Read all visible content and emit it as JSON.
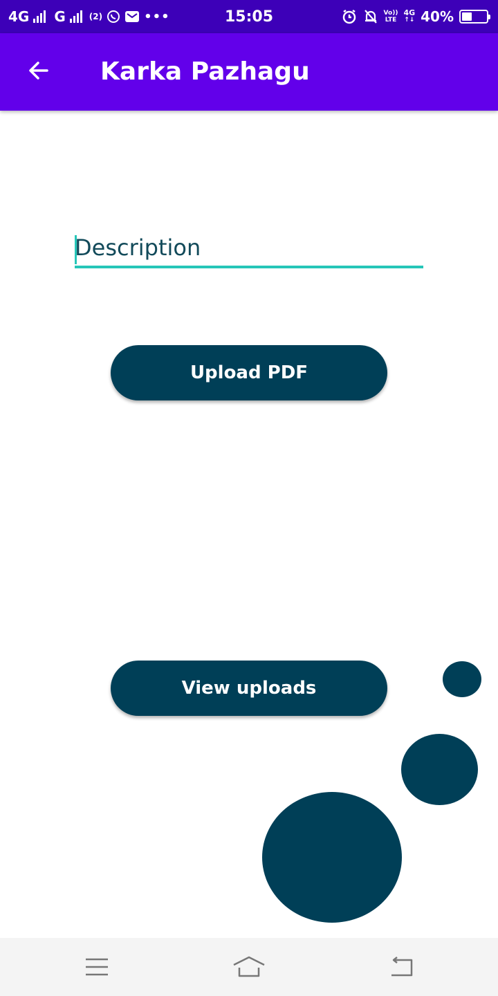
{
  "status_bar": {
    "network_1": "4G",
    "network_2": "G",
    "sim_badge": "(2)",
    "time": "15:05",
    "volte_top": "Vo))",
    "volte_bottom": "LTE",
    "net_right_top": "4G",
    "net_right_bottom": "↑↓",
    "battery_percent": "40%",
    "battery_level": 0.4,
    "icons": [
      "signal-icon",
      "sim-icon",
      "whatsapp-icon",
      "mail-icon",
      "more-dots-icon",
      "alarm-icon",
      "mute-icon",
      "battery-icon"
    ]
  },
  "app_bar": {
    "title": "Karka Pazhagu",
    "back_icon": "arrow-left-icon",
    "background": "#6200ea"
  },
  "form": {
    "description_placeholder": "Description",
    "description_value": "",
    "accent_color": "#26c6b8"
  },
  "buttons": {
    "upload_label": "Upload PDF",
    "view_label": "View uploads",
    "color": "#003f57"
  },
  "nav_bar": {
    "icons": [
      "menu-icon",
      "home-icon",
      "back-icon"
    ]
  }
}
